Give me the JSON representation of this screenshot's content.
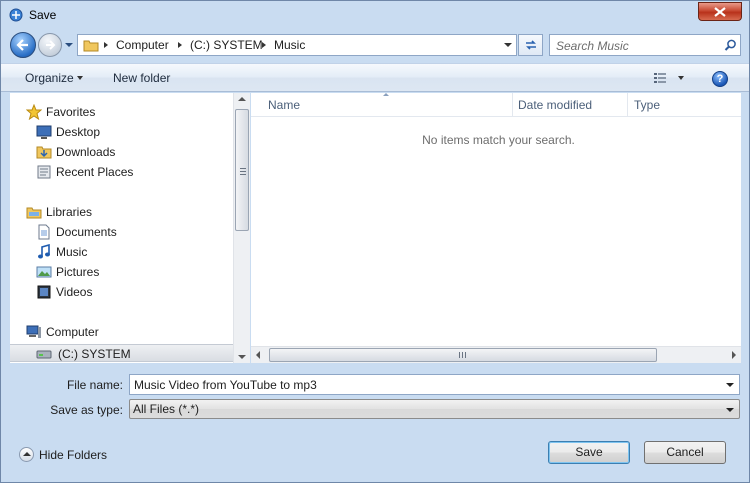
{
  "window": {
    "title": "Save"
  },
  "address": {
    "crumbs": [
      "Computer",
      "(C:) SYSTEM",
      "Music"
    ]
  },
  "search": {
    "placeholder": "Search Music"
  },
  "toolbar": {
    "organize": "Organize",
    "new_folder": "New folder"
  },
  "nav": {
    "favorites": {
      "label": "Favorites",
      "items": [
        "Desktop",
        "Downloads",
        "Recent Places"
      ]
    },
    "libraries": {
      "label": "Libraries",
      "items": [
        "Documents",
        "Music",
        "Pictures",
        "Videos"
      ]
    },
    "computer": {
      "label": "Computer",
      "items": [
        "(C:) SYSTEM"
      ]
    }
  },
  "filelist": {
    "columns": [
      "Name",
      "Date modified",
      "Type"
    ],
    "empty_message": "No items match your search."
  },
  "form": {
    "file_name_label": "File name:",
    "file_name_value": "Music Video from YouTube to mp3",
    "save_as_type_label": "Save as type:",
    "save_as_type_value": "All Files (*.*)"
  },
  "footer": {
    "hide_folders": "Hide Folders",
    "save": "Save",
    "cancel": "Cancel"
  }
}
